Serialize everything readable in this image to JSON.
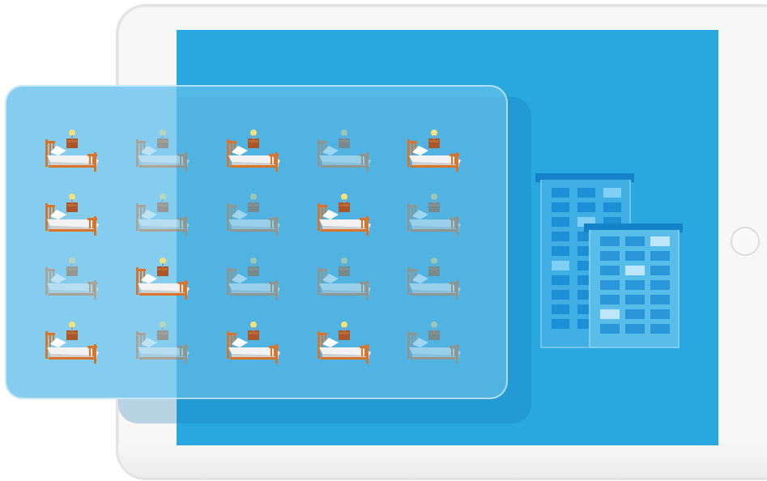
{
  "illustration": {
    "subject": "tablet-with-room-occupancy",
    "colors": {
      "screen": "#29a8e0",
      "glass_panel": "#95d3f0",
      "building_roof": "#1382c9",
      "bed_frame": "#d9742b",
      "mattress": "#f2f2f2",
      "lamp": "#f6e27a"
    },
    "icons": [
      "bed-icon",
      "nightstand-lamp-icon",
      "building-icon"
    ],
    "beds": {
      "rows": 4,
      "columns": 5,
      "occupied_pattern": [
        [
          true,
          false,
          true,
          false,
          true
        ],
        [
          true,
          false,
          false,
          true,
          false
        ],
        [
          false,
          true,
          false,
          false,
          false
        ],
        [
          true,
          false,
          true,
          true,
          false
        ]
      ]
    }
  }
}
